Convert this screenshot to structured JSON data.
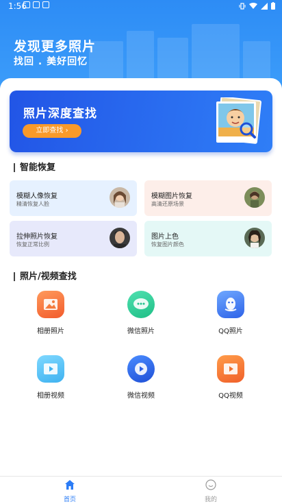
{
  "status_bar": {
    "time": "1:56"
  },
  "hero": {
    "headline": "发现更多照片",
    "subhead": "找回 . 美好回忆"
  },
  "banner": {
    "title": "照片深度查找",
    "button": "立即查找 ›"
  },
  "smart_recovery": {
    "title": "智能恢复",
    "cards": [
      {
        "title": "模糊人像恢复",
        "subtitle": "精清恢复人脸",
        "bg": "#e6f1ff"
      },
      {
        "title": "模糊图片恢复",
        "subtitle": "高清还原场景",
        "bg": "#fdeee9"
      },
      {
        "title": "拉伸照片恢复",
        "subtitle": "恢复正常比例",
        "bg": "#e7e9fb"
      },
      {
        "title": "图片上色",
        "subtitle": "恢复图片颜色",
        "bg": "#e4f8f6"
      }
    ]
  },
  "photo_video_search": {
    "title": "照片/视频查找",
    "tiles": [
      {
        "label": "相册照片",
        "icon": "album-photo-icon"
      },
      {
        "label": "微信照片",
        "icon": "wechat-photo-icon"
      },
      {
        "label": "QQ照片",
        "icon": "qq-photo-icon"
      },
      {
        "label": "相册视频",
        "icon": "album-video-icon"
      },
      {
        "label": "微信视频",
        "icon": "wechat-video-icon"
      },
      {
        "label": "QQ视频",
        "icon": "qq-video-icon"
      }
    ]
  },
  "tabbar": {
    "home": "首页",
    "me": "我的",
    "active_color": "#2b7cf6",
    "inactive_color": "#9a9a9a"
  }
}
